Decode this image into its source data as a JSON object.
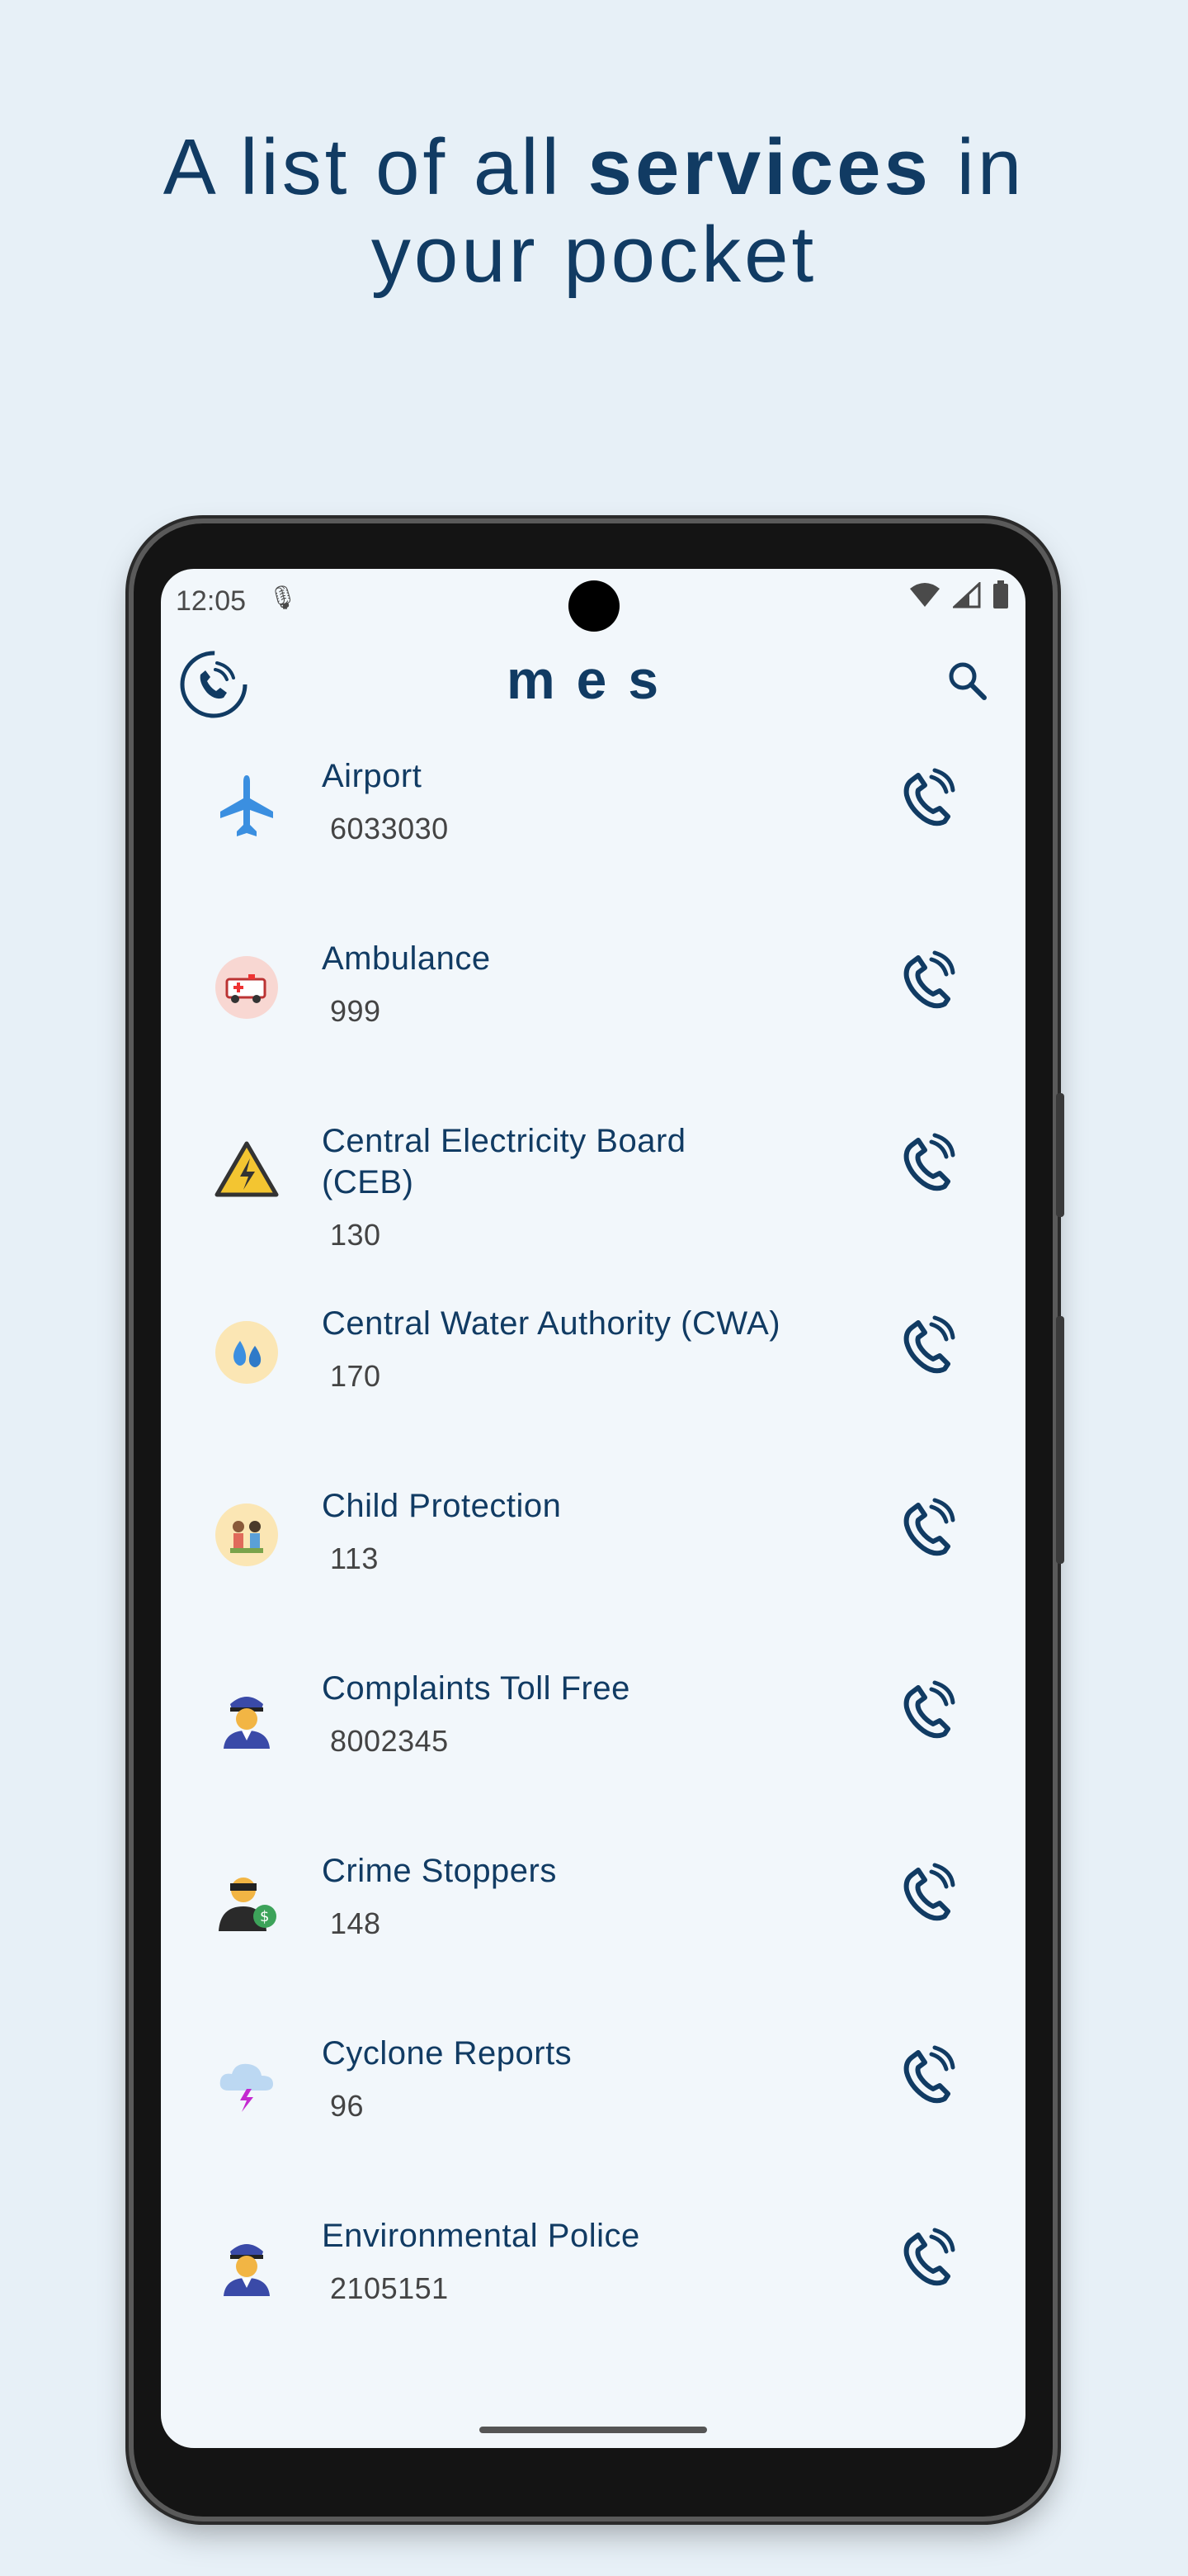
{
  "headline": {
    "part1": "A list of all ",
    "bold": "services",
    "part2": " in",
    "line2": "your pocket"
  },
  "status": {
    "time": "12:05"
  },
  "app": {
    "title": "mes"
  },
  "colors": {
    "primary": "#113b63",
    "background": "#e7f0f7",
    "screen": "#f2f7fb"
  },
  "services": [
    {
      "name": "Airport",
      "number": "6033030",
      "icon": "airplane-icon"
    },
    {
      "name": "Ambulance",
      "number": "999",
      "icon": "ambulance-icon"
    },
    {
      "name": "Central Electricity Board (CEB)",
      "number": "130",
      "icon": "electricity-warning-icon"
    },
    {
      "name": "Central Water Authority (CWA)",
      "number": "170",
      "icon": "water-drops-icon"
    },
    {
      "name": "Child Protection",
      "number": "113",
      "icon": "children-icon"
    },
    {
      "name": "Complaints Toll Free",
      "number": "8002345",
      "icon": "police-officer-icon"
    },
    {
      "name": "Crime Stoppers",
      "number": "148",
      "icon": "thief-icon"
    },
    {
      "name": "Cyclone Reports",
      "number": "96",
      "icon": "storm-cloud-icon"
    },
    {
      "name": "Environmental Police",
      "number": "2105151",
      "icon": "police-officer-icon"
    }
  ]
}
